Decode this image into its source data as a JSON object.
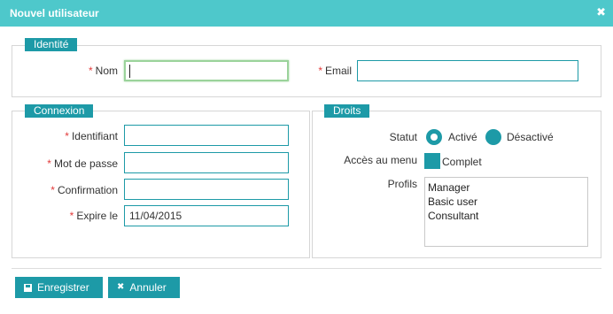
{
  "dialog": {
    "title": "Nouvel utilisateur",
    "close_icon": "close-icon"
  },
  "identite": {
    "legend": "Identité",
    "nom": {
      "label": "Nom",
      "value": "",
      "required": true
    },
    "email": {
      "label": "Email",
      "value": "",
      "required": true
    }
  },
  "connexion": {
    "legend": "Connexion",
    "identifiant": {
      "label": "Identifiant",
      "value": "",
      "required": true
    },
    "mot_de_passe": {
      "label": "Mot de passe",
      "value": "",
      "required": true
    },
    "confirmation": {
      "label": "Confirmation",
      "value": "",
      "required": true
    },
    "expire_le": {
      "label": "Expire le",
      "value": "11/04/2015",
      "required": true
    }
  },
  "droits": {
    "legend": "Droits",
    "statut": {
      "label": "Statut",
      "options": [
        {
          "label": "Activé",
          "selected": true
        },
        {
          "label": "Désactivé",
          "selected": false
        }
      ]
    },
    "acces_menu": {
      "label": "Accès au menu",
      "option_label": "Complet"
    },
    "profils": {
      "label": "Profils",
      "options": [
        "Manager",
        "Basic user",
        "Consultant"
      ]
    }
  },
  "required_marker": "*",
  "actions": {
    "save_label": "Enregistrer",
    "save_icon": "floppy-disk-icon",
    "cancel_label": "Annuler",
    "cancel_icon": "x-icon"
  },
  "colors": {
    "titlebar": "#4ec8cb",
    "accent": "#1d9aa7",
    "required": "#e23a3a",
    "focus": "#9bd39b"
  }
}
